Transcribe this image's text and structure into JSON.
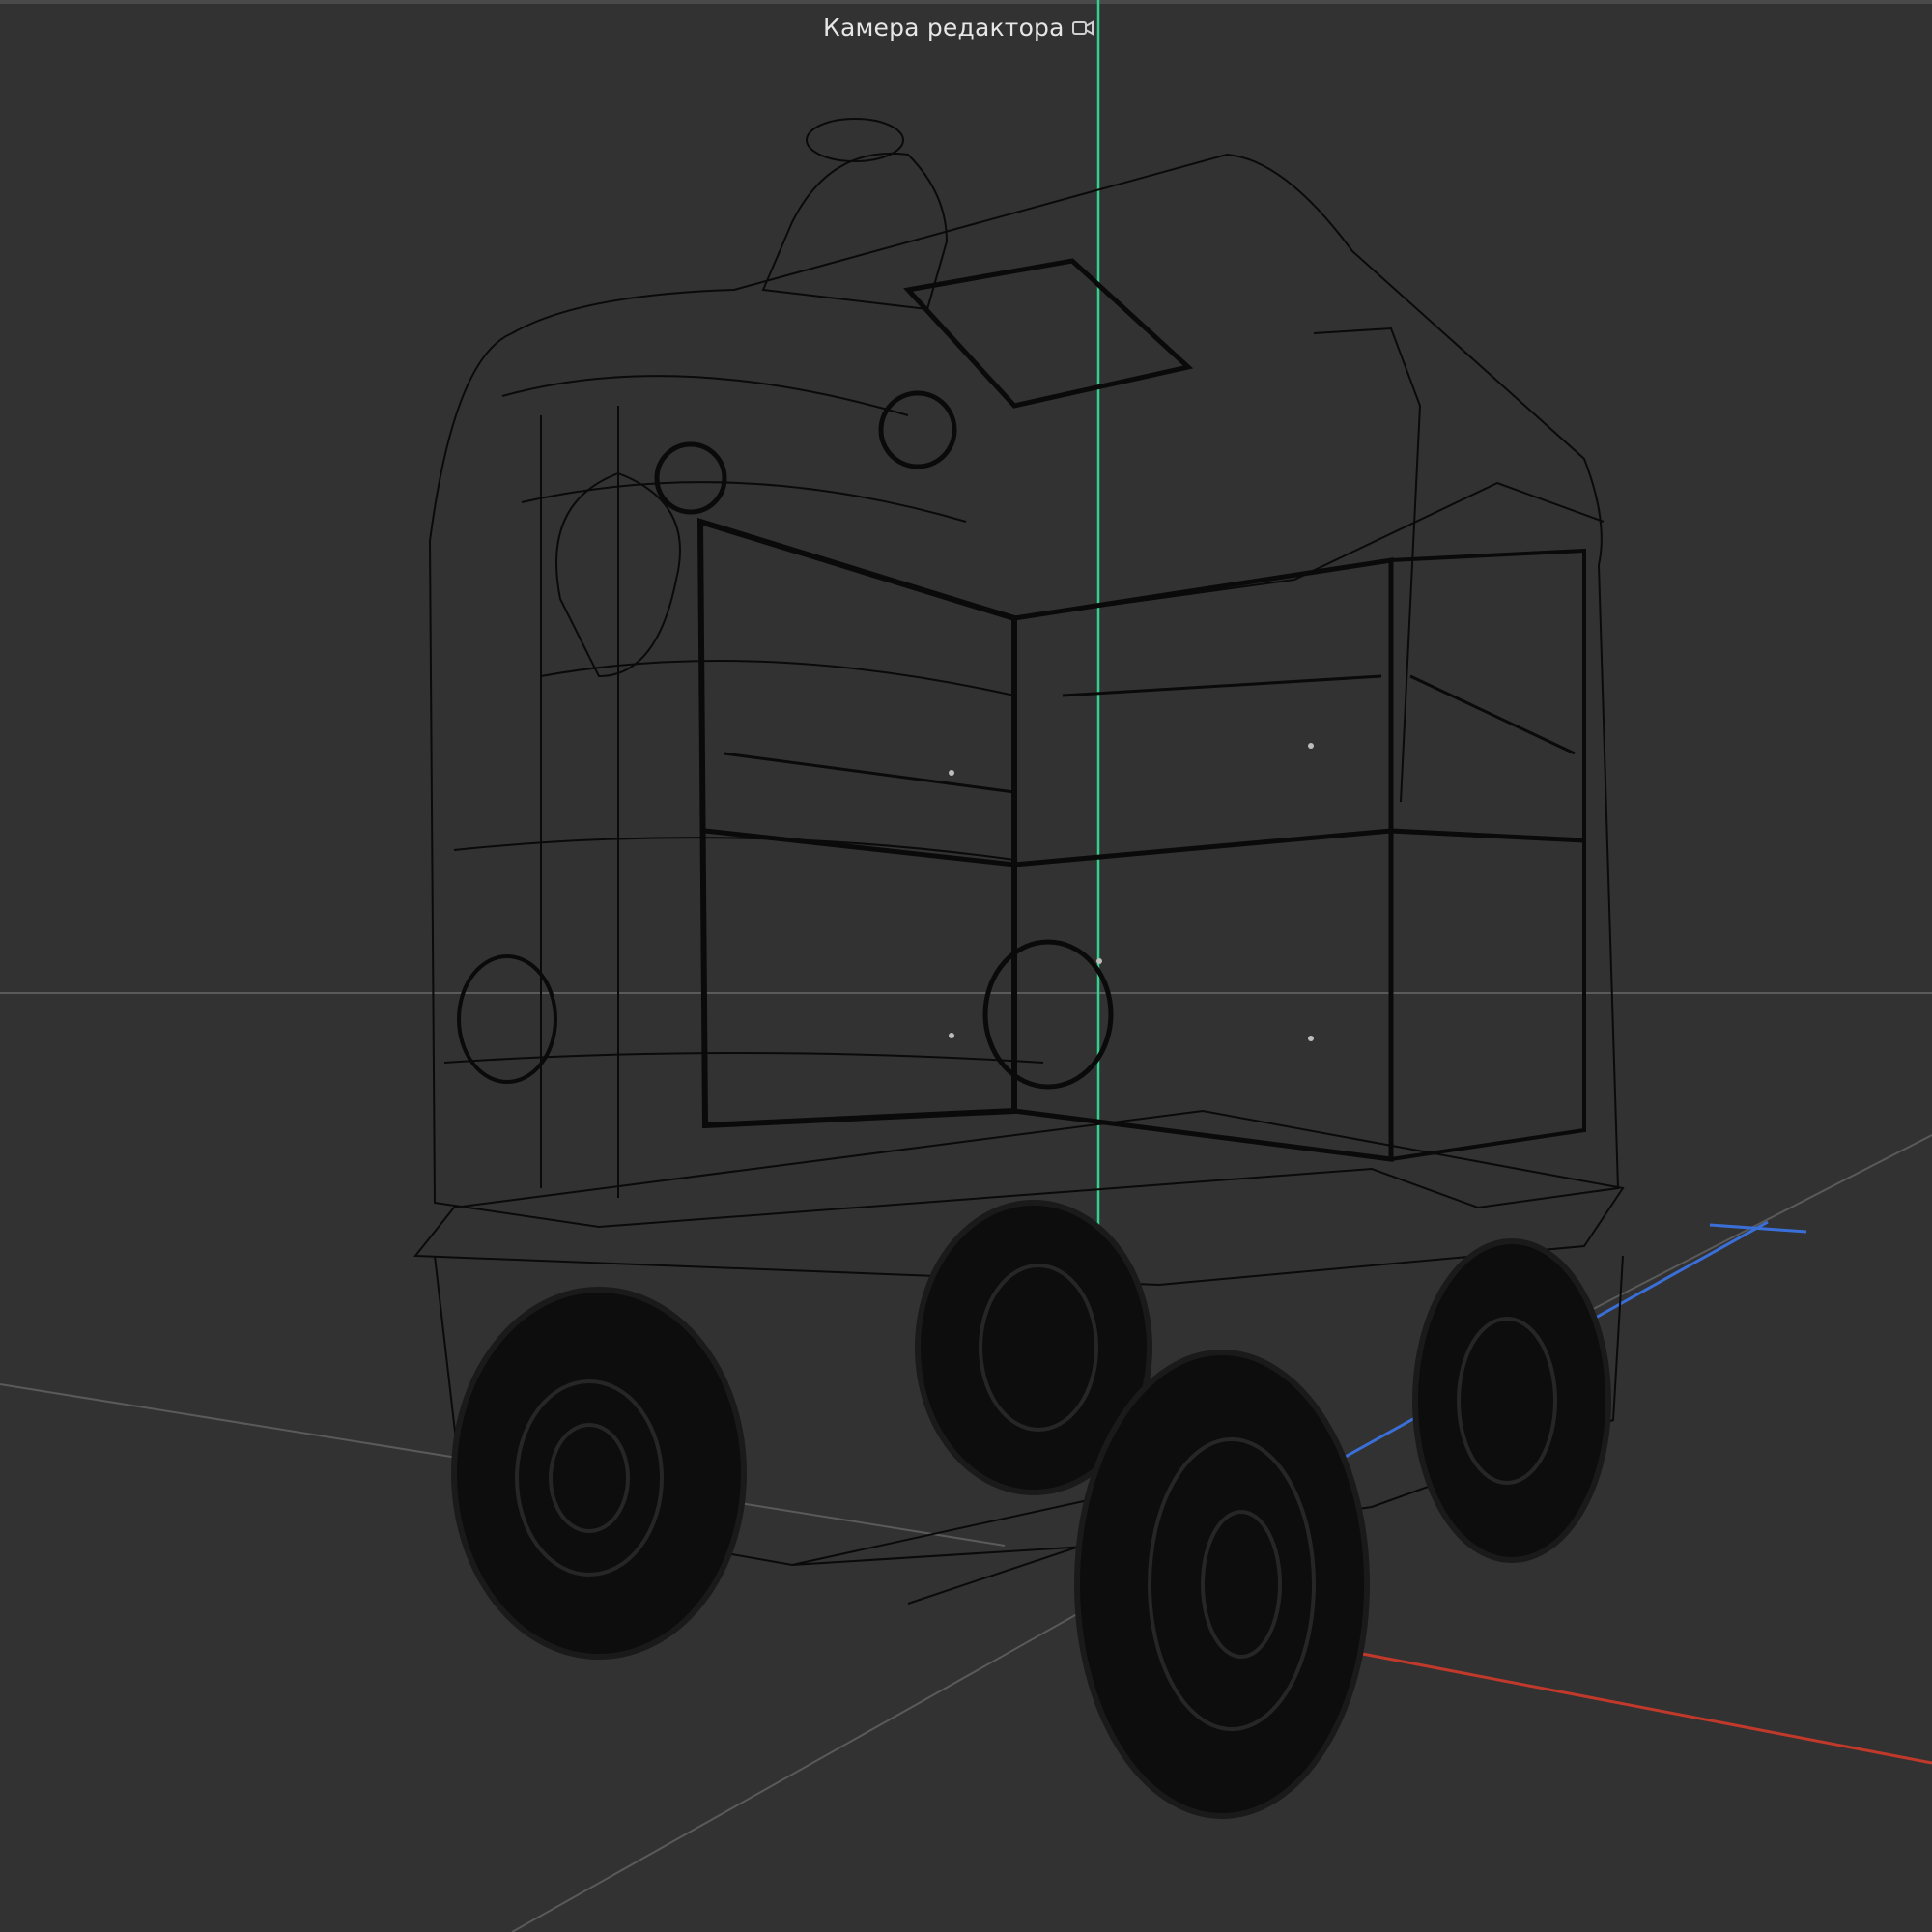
{
  "viewport": {
    "camera_label": "Камера редактора",
    "camera_icon": "camera-icon",
    "colors": {
      "background": "#323232",
      "grid": "#5a5a5a",
      "axis_x": "#c0392b",
      "axis_y": "#33d18f",
      "axis_z": "#3a6fd8",
      "wireframe": "#0a0a0a"
    }
  }
}
